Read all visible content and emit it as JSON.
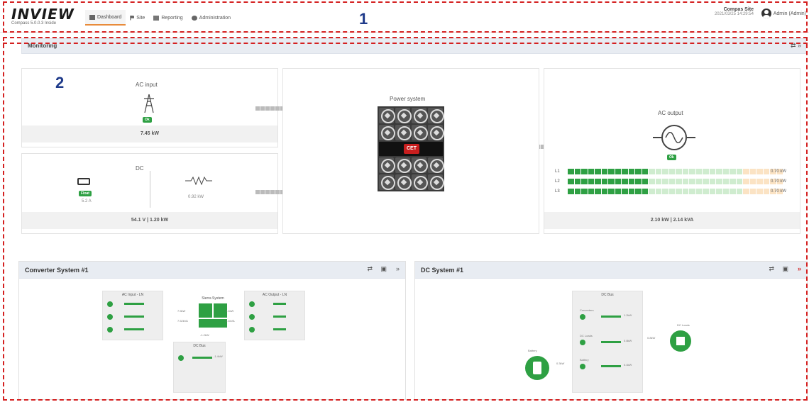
{
  "header": {
    "logo": "INVIEW",
    "logo_sub": "Compass 5.0.0.3 Inside",
    "nav": [
      {
        "label": "Dashboard",
        "icon": "dashboard-icon",
        "active": true
      },
      {
        "label": "Site",
        "icon": "flag-icon",
        "active": false
      },
      {
        "label": "Reporting",
        "icon": "report-icon",
        "active": false
      },
      {
        "label": "Administration",
        "icon": "gear-icon",
        "active": false
      }
    ],
    "site_name": "Compas Site",
    "site_time": "2021/03/25 14:29:54",
    "user_label": "Admin (Admin)"
  },
  "annotations": {
    "callout_1": "1",
    "callout_2": "2"
  },
  "monitoring": {
    "title": "Monitoring",
    "ac_input": {
      "label": "AC input",
      "status": "Ok",
      "footer": "7.45 kW"
    },
    "dc": {
      "label": "DC",
      "status": "Float",
      "battery_current": "5.2 A",
      "load_power": "0.92 kW",
      "footer_voltage": "54.1 V",
      "footer_power": "1.20 kW"
    },
    "power_system": {
      "label": "Power system",
      "brand": "CET"
    },
    "ac_output": {
      "label": "AC output",
      "status": "Ok",
      "phases": [
        {
          "label": "L1",
          "value": "0.70 kW"
        },
        {
          "label": "L2",
          "value": "0.70 kW"
        },
        {
          "label": "L3",
          "value": "0.70 kW"
        }
      ],
      "footer_power": "2.10 kW",
      "footer_apparent": "2.14 kVA"
    },
    "colors": {
      "ok": "#2ea043",
      "bar_active": "#2ea043",
      "bar_idle": "#cfeccf",
      "bar_warn": "#fbe3c4"
    }
  },
  "converter_panel": {
    "title": "Converter System #1",
    "ac_input_title": "AC Input - LN",
    "ac_output_title": "AC Output - LN",
    "system_title": "Sierra System",
    "dc_bus_title": "DC Bus",
    "left_power": "7.5kW",
    "left_apparent": "7.52kVA",
    "right_power": "2.1kW",
    "right_apparent": "2.1kVA",
    "dc_power": "-1.2kW",
    "dc_bar_value": "-1.4kW"
  },
  "dc_panel": {
    "title": "DC System #1",
    "dc_bus_title": "DC Bus",
    "converters_label": "Converters",
    "dc_loads_label": "DC Loads",
    "battery_label": "Battery",
    "battery_node_label": "Battery",
    "dc_loads_node_label": "DC Loads",
    "converters_value": "1.2kW",
    "dc_loads_value": "0.8kW",
    "battery_value": "0.4kW",
    "battery_flow": "0.3kW",
    "loads_flow": "0.8kW"
  }
}
